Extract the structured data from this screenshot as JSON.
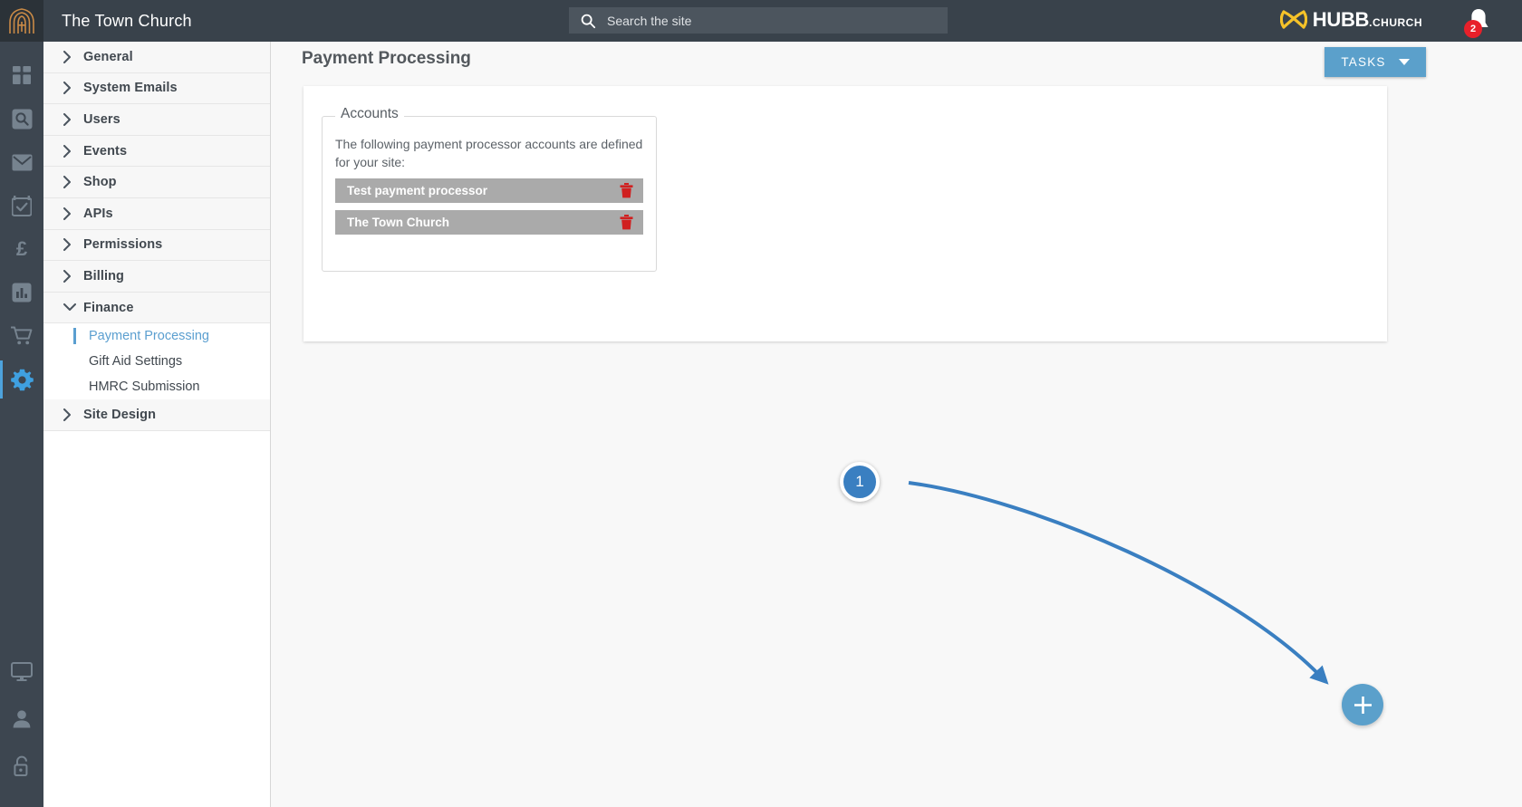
{
  "topbar": {
    "logo_icon": "church-arch-cross-icon",
    "site_title": "The Town Church",
    "search": {
      "icon": "search-icon",
      "placeholder": "Search the site",
      "value": ""
    },
    "brand": {
      "icon": "hubb-butterfly-icon",
      "name": "HUBB",
      "suffix": ".CHURCH"
    },
    "notifications": {
      "icon": "bell-icon",
      "count": "2",
      "badge_color": "#e8202a"
    },
    "background": "#39424b"
  },
  "rail": {
    "top_items": [
      {
        "name": "dashboard-icon",
        "active": false
      },
      {
        "name": "search-icon",
        "active": false
      },
      {
        "name": "mail-icon",
        "active": false
      },
      {
        "name": "calendar-check-icon",
        "active": false
      },
      {
        "name": "pound-icon",
        "label": "£",
        "active": false
      },
      {
        "name": "bar-chart-icon",
        "active": false
      },
      {
        "name": "shopping-cart-icon",
        "active": false
      },
      {
        "name": "gear-icon",
        "active": true
      }
    ],
    "bottom_items": [
      {
        "name": "monitor-icon"
      },
      {
        "name": "person-icon"
      },
      {
        "name": "unlock-icon"
      }
    ],
    "active_color": "#4da3dd",
    "background": "#3d4650"
  },
  "nav": {
    "groups": [
      {
        "label": "General",
        "expanded": false
      },
      {
        "label": "System Emails",
        "expanded": false
      },
      {
        "label": "Users",
        "expanded": false
      },
      {
        "label": "Events",
        "expanded": false
      },
      {
        "label": "Shop",
        "expanded": false
      },
      {
        "label": "APIs",
        "expanded": false
      },
      {
        "label": "Permissions",
        "expanded": false
      },
      {
        "label": "Billing",
        "expanded": false
      },
      {
        "label": "Finance",
        "expanded": true,
        "children": [
          {
            "label": "Payment Processing",
            "active": true
          },
          {
            "label": "Gift Aid Settings",
            "active": false
          },
          {
            "label": "HMRC Submission",
            "active": false
          }
        ]
      },
      {
        "label": "Site Design",
        "expanded": false
      }
    ],
    "active_color": "#5b9fd0"
  },
  "main": {
    "page_title": "Payment Processing",
    "tasks_button": {
      "label": "TASKS",
      "icon": "chevron-down-icon",
      "color": "#5ba0cb"
    },
    "card": {
      "fieldset_legend": "Accounts",
      "description": "The following payment processor accounts are defined for your site:",
      "accounts": [
        {
          "name": "Test payment processor",
          "delete_icon": "trash-icon"
        },
        {
          "name": "The Town Church",
          "delete_icon": "trash-icon"
        }
      ],
      "row_color": "#aaaaaa",
      "trash_color": "#d02020"
    }
  },
  "annotation": {
    "step_number": "1",
    "step_color": "#3a7fc1",
    "arrow_color": "#3a7fc1",
    "arrow_from": "step-badge",
    "arrow_to": "add-account-fab"
  },
  "fab": {
    "icon": "plus-icon",
    "label": "+",
    "color": "#5ba0cb"
  }
}
